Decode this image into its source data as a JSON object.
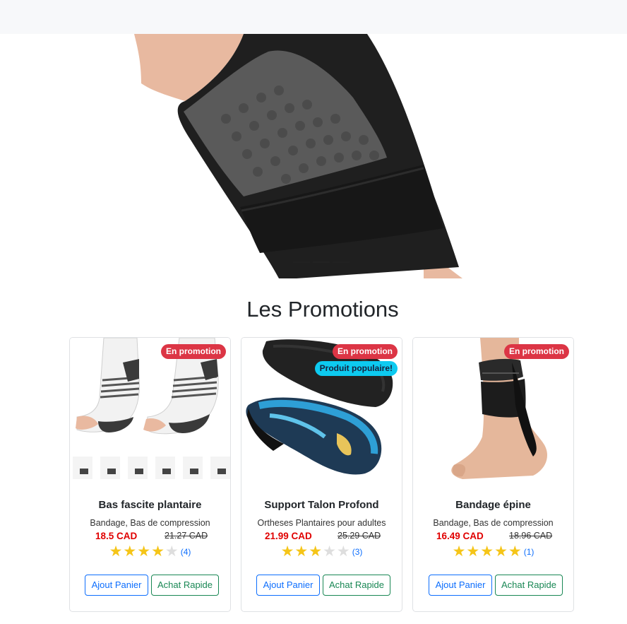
{
  "section_title": "Les Promotions",
  "products": [
    {
      "title": "Bas fascite plantaire",
      "category": "Bandage, Bas de compression",
      "price": "18.5 CAD",
      "old_price": "21.27 CAD",
      "rating": 4,
      "review_count": "(4)",
      "badges": [
        "En promotion"
      ],
      "add_to_cart": "Ajout Panier",
      "quick_buy": "Achat Rapide"
    },
    {
      "title": "Support Talon Profond",
      "category": "Ortheses Plantaires pour adultes",
      "price": "21.99 CAD",
      "old_price": "25.29 CAD",
      "rating": 3,
      "review_count": "(3)",
      "badges": [
        "En promotion",
        "Produit populaire!"
      ],
      "add_to_cart": "Ajout Panier",
      "quick_buy": "Achat Rapide"
    },
    {
      "title": "Bandage épine",
      "category": "Bandage, Bas de compression",
      "price": "16.49 CAD",
      "old_price": "18.96 CAD",
      "rating": 5,
      "review_count": "(1)",
      "badges": [
        "En promotion"
      ],
      "add_to_cart": "Ajout Panier",
      "quick_buy": "Achat Rapide"
    }
  ],
  "carousel": {
    "slide_count": 3,
    "active_index": 1
  },
  "colors": {
    "promo_badge": "#dc3545",
    "popular_badge": "#0dcaf0",
    "price": "#e00000",
    "star": "#f5c518",
    "primary": "#0d6efd",
    "success": "#198754"
  }
}
